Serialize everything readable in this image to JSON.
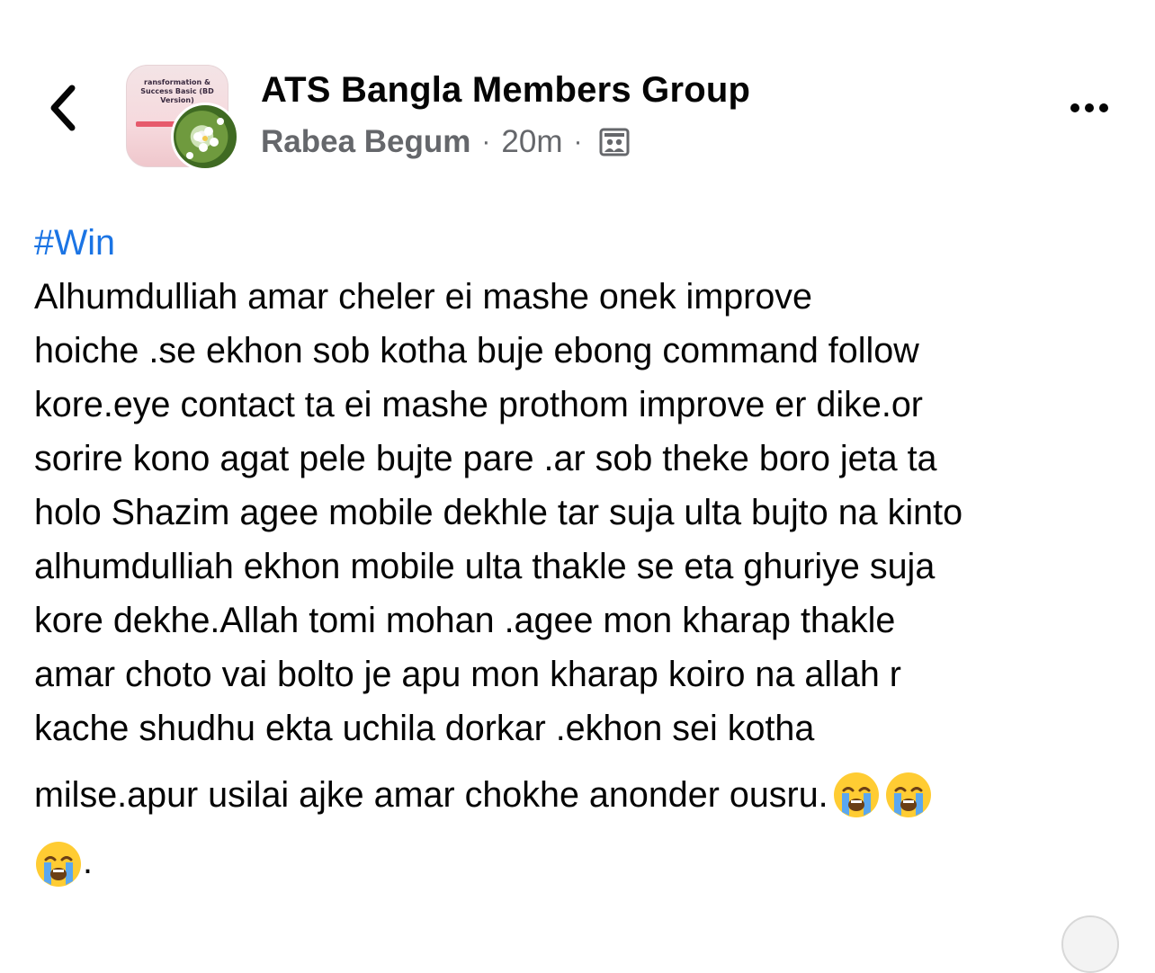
{
  "header": {
    "group_name": "ATS Bangla Members Group",
    "author": "Rabea Begum",
    "separator": "·",
    "time": "20m",
    "group_avatar_text": "ransformation & Success Basic (BD Version)"
  },
  "post": {
    "hashtag": "#Win",
    "lines": [
      "Alhumdulliah amar cheler ei mashe onek improve",
      "hoiche .se ekhon sob kotha buje ebong command follow",
      "kore.eye contact ta ei mashe prothom improve er dike.or",
      "sorire kono agat pele bujte pare .ar sob theke boro jeta ta",
      "holo Shazim agee mobile dekhle tar suja ulta bujto na kinto",
      "alhumdulliah ekhon mobile ulta thakle se eta ghuriye suja",
      "kore dekhe.Allah tomi mohan .agee mon kharap thakle",
      "amar choto vai bolto je apu mon kharap koiro na allah r",
      "kache shudhu ekta uchila dorkar .ekhon sei kotha"
    ],
    "line_with_emoji": "milse.apur usilai ajke amar chokhe anonder ousru.",
    "trailing": "."
  },
  "icons": {
    "back": "chevron-left-icon",
    "more": "more-horizontal-icon",
    "audience": "group-audience-icon",
    "emoji": "loudly-crying-face-emoji"
  }
}
